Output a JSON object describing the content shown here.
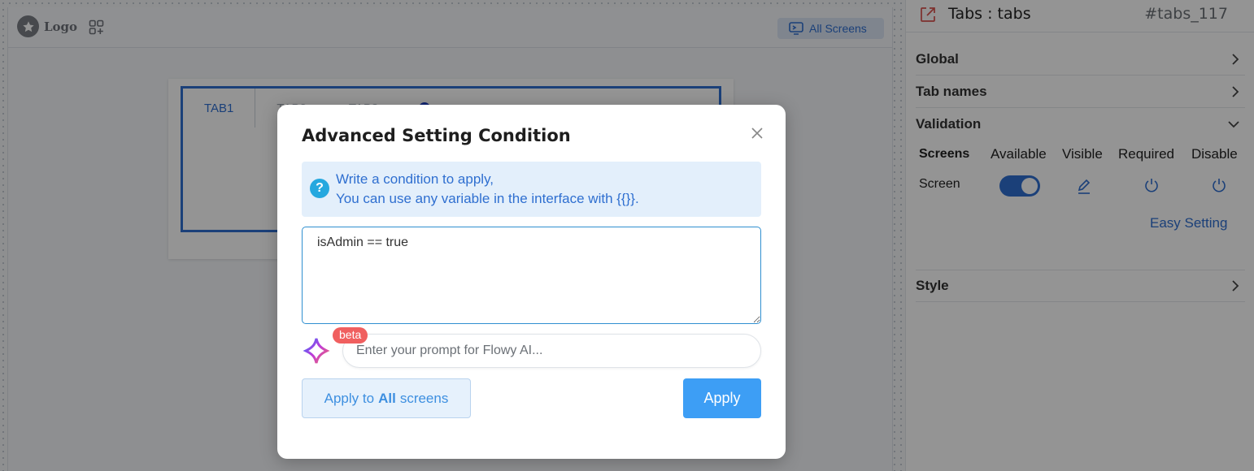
{
  "canvas": {
    "logo_text": "Logo",
    "all_screens_label": "All Screens",
    "tabs": [
      {
        "label": "TAB1"
      },
      {
        "label": "TAB2"
      },
      {
        "label": "TAB3"
      }
    ]
  },
  "panel": {
    "title": "Tabs : tabs",
    "element_id": "#tabs_117",
    "sections": {
      "global": "Global",
      "tab_names": "Tab names",
      "validation": "Validation",
      "style": "Style"
    },
    "validation": {
      "columns": [
        "Screens",
        "Available",
        "Visible",
        "Required",
        "Disable"
      ],
      "row_label": "Screen",
      "available_on": true,
      "easy_setting_label": "Easy Setting"
    }
  },
  "modal": {
    "title": "Advanced Setting Condition",
    "info_line1": "Write a condition to apply,",
    "info_line2": "You can use any variable in the interface with {{}}.",
    "condition_value": "isAdmin == true",
    "beta_label": "beta",
    "ai_placeholder": "Enter your prompt for Flowy AI...",
    "apply_all_prefix": "Apply to",
    "apply_all_bold": "All",
    "apply_all_suffix": "screens",
    "apply_label": "Apply"
  },
  "colors": {
    "accent": "#2f6fd0",
    "apply_button": "#3d9ef5",
    "beta_badge": "#f05f5f",
    "info_bg": "#e3effb"
  }
}
